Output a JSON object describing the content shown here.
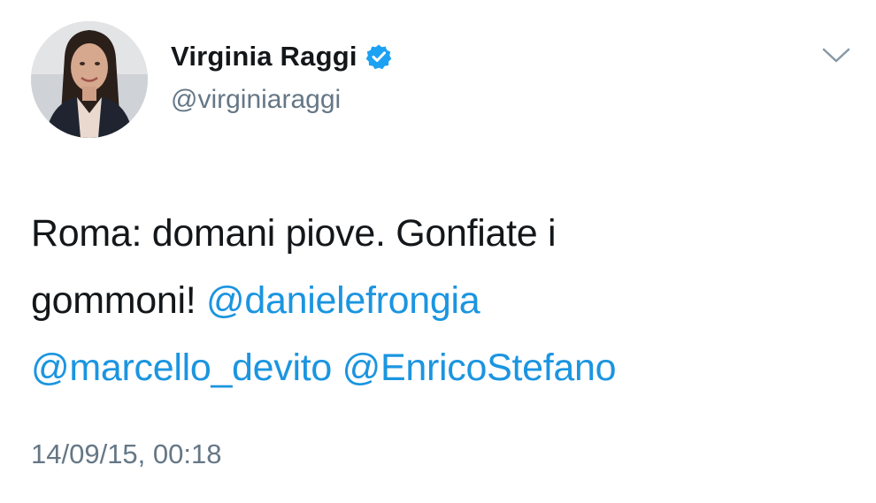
{
  "author": {
    "display_name": "Virginia Raggi",
    "handle": "@virginiaraggi",
    "verified": true,
    "avatar_icon": "profile-photo"
  },
  "menu": {
    "icon": "chevron-down-icon"
  },
  "tweet": {
    "text_line_1": "Roma: domani piove. Gonfiate i",
    "text_line_2_plain": "gommoni! ",
    "mentions": [
      "@danielefrongia",
      "@marcello_devito",
      "@EnricoStefano"
    ],
    "timestamp": "14/09/15, 00:18"
  },
  "colors": {
    "text": "#14171a",
    "secondary": "#657786",
    "link": "#1b95e0",
    "verified_badge": "#1da1f2"
  }
}
